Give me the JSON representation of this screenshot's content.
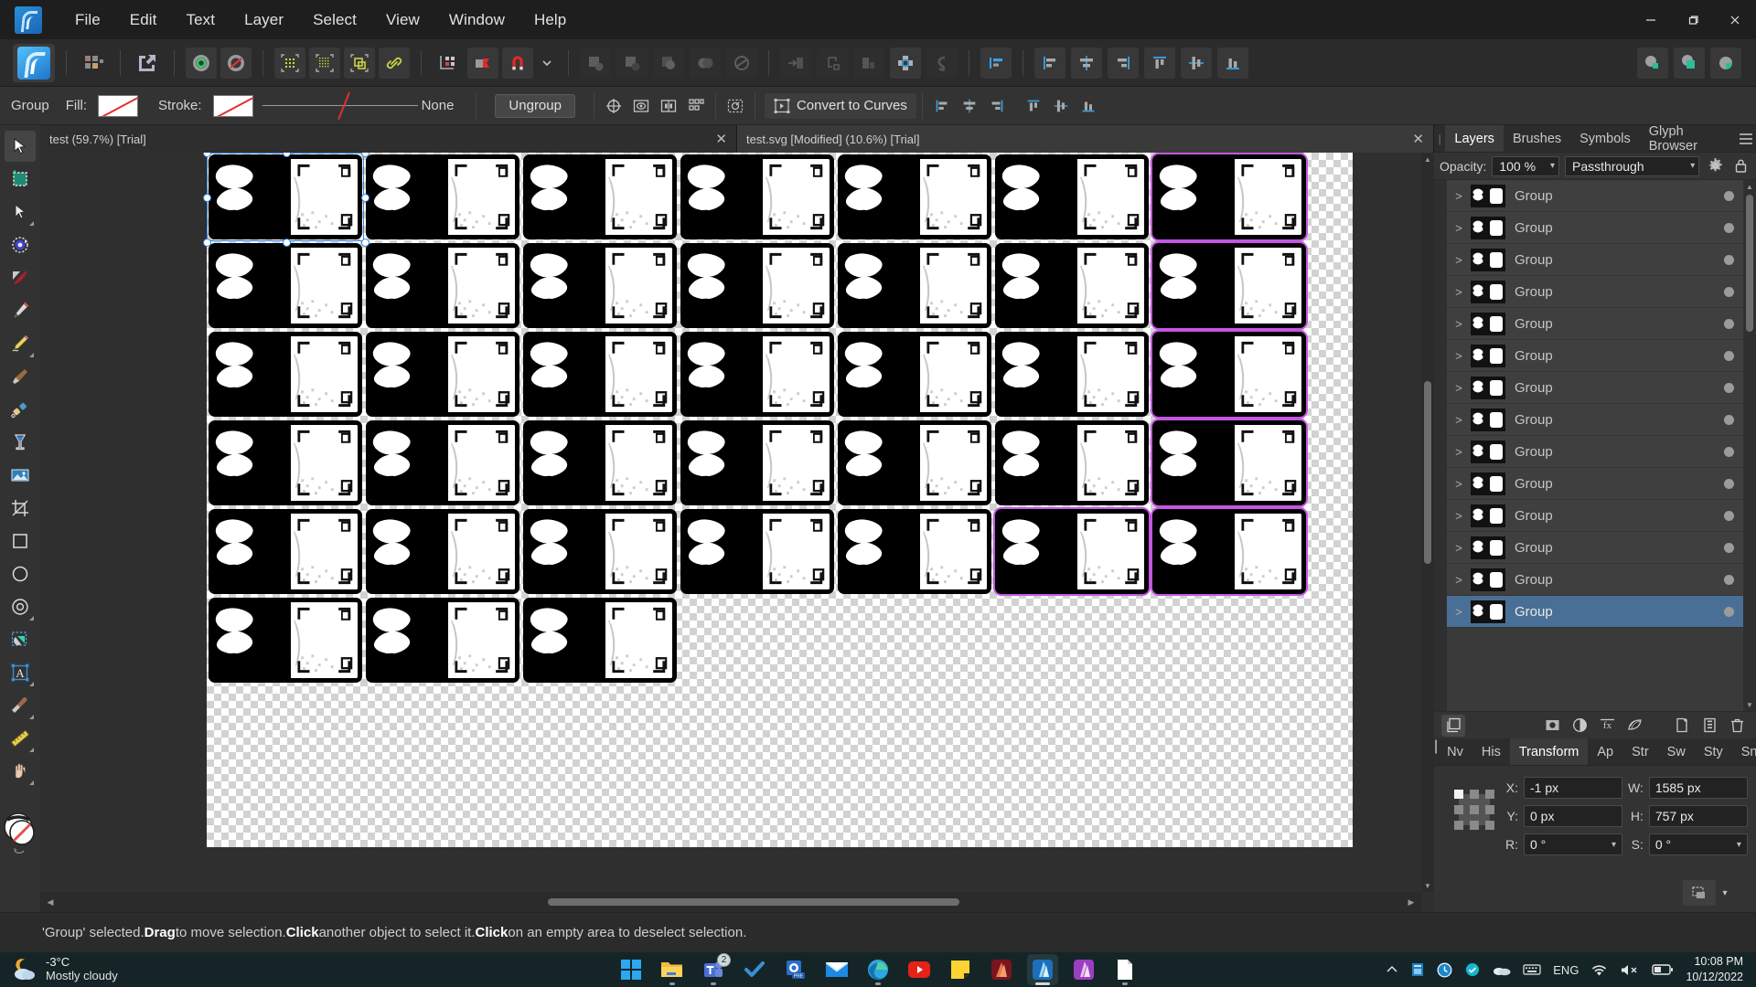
{
  "app": {
    "name": "Affinity Designer",
    "menu": [
      "File",
      "Edit",
      "Text",
      "Layer",
      "Select",
      "View",
      "Window",
      "Help"
    ],
    "window_controls": {
      "minimize": "—",
      "maximize": "▢",
      "close": "✕"
    }
  },
  "context_toolbar": {
    "object_label": "Group",
    "fill_label": "Fill:",
    "stroke_label": "Stroke:",
    "stroke_width_value": "None",
    "ungroup_label": "Ungroup",
    "convert_label": "Convert to Curves"
  },
  "document_tabs": [
    {
      "title": "test (59.7%) [Trial]",
      "close": "✕",
      "active": false
    },
    {
      "title": "test.svg [Modified] (10.6%) [Trial]",
      "close": "✕",
      "active": true
    }
  ],
  "right_panel": {
    "tabs": [
      "Layers",
      "Brushes",
      "Symbols",
      "Glyph Browser"
    ],
    "active_tab": "Layers",
    "opacity_label": "Opacity:",
    "opacity_value": "100 %",
    "blend_mode": "Passthrough",
    "layers": [
      {
        "name": "Group",
        "selected": false
      },
      {
        "name": "Group",
        "selected": false
      },
      {
        "name": "Group",
        "selected": false
      },
      {
        "name": "Group",
        "selected": false
      },
      {
        "name": "Group",
        "selected": false
      },
      {
        "name": "Group",
        "selected": false
      },
      {
        "name": "Group",
        "selected": false
      },
      {
        "name": "Group",
        "selected": false
      },
      {
        "name": "Group",
        "selected": false
      },
      {
        "name": "Group",
        "selected": false
      },
      {
        "name": "Group",
        "selected": false
      },
      {
        "name": "Group",
        "selected": false
      },
      {
        "name": "Group",
        "selected": false
      },
      {
        "name": "Group",
        "selected": true
      }
    ]
  },
  "transform_panel": {
    "tabs": [
      "Nv",
      "His",
      "Transform",
      "Ap",
      "Str",
      "Sw",
      "Sty",
      "Snp"
    ],
    "active_tab": "Transform",
    "fields": {
      "x_label": "X:",
      "x_value": "-1 px",
      "y_label": "Y:",
      "y_value": "0 px",
      "w_label": "W:",
      "w_value": "1585 px",
      "h_label": "H:",
      "h_value": "757 px",
      "r_label": "R:",
      "r_value": "0 °",
      "s_label": "S:",
      "s_value": "0 °"
    }
  },
  "status_bar": {
    "prefix": "'Group' selected. ",
    "b1": "Drag",
    "t1": " to move selection. ",
    "b2": "Click",
    "t2": " another object to select it. ",
    "b3": "Click",
    "t3": " on an empty area to deselect selection."
  },
  "taskbar": {
    "weather_temp": "-3°C",
    "weather_desc": "Mostly cloudy",
    "teams_badge": "2",
    "language": "ENG",
    "time": "10:08 PM",
    "date": "10/12/2022",
    "apps": [
      "start-icon",
      "file-explorer-icon",
      "teams-icon",
      "todo-icon",
      "office-icon",
      "mail-icon",
      "edge-icon",
      "youtube-icon",
      "sticky-notes-icon",
      "affinity-photo-icon",
      "affinity-designer-icon",
      "affinity-publisher-icon",
      "text-editor-icon"
    ]
  },
  "canvas": {
    "grid_columns": 7,
    "grid_full_rows": 5,
    "last_row_count": 3,
    "selected_card_index": 0,
    "purple_selection_indices": [
      6,
      13,
      20,
      27,
      33,
      34
    ],
    "zoom": "10.6%"
  },
  "tools": [
    "move-tool",
    "artboard-tool",
    "node-tool",
    "corner-tool",
    "pen-tool",
    "vector-brush-tool",
    "pencil-tool",
    "fill-tool",
    "gradient-tool",
    "shape-builder-tool",
    "place-image-tool",
    "crop-tool",
    "rectangle-tool",
    "ellipse-tool",
    "donut-tool",
    "vector-crop-tool",
    "artistic-text-tool",
    "color-picker-tool",
    "measure-tool",
    "hand-tool",
    "color-swatch"
  ],
  "colors": {
    "accent_blue": "#2d86e8",
    "purple_select": "#c456e0",
    "panel_bg": "#333333",
    "toolbar_bg": "#2b2b2b",
    "menubar_bg": "#1e1e1e",
    "layer_selected": "#4a6f96",
    "taskbar_bg": "#152527",
    "teal_accent": "#2bbd9a"
  }
}
